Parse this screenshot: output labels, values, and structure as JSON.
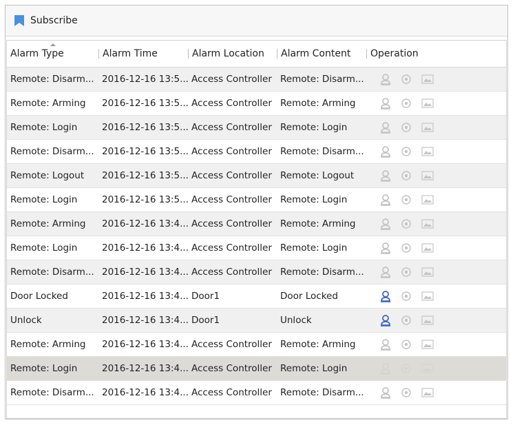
{
  "toolbar": {
    "subscribe_label": "Subscribe",
    "accent": "#4a8fe0"
  },
  "table": {
    "columns": [
      "Alarm Type",
      "Alarm Time",
      "Alarm Location",
      "Alarm Content",
      "Operation"
    ],
    "sorted_column": "Alarm Type",
    "selected_row": 12,
    "rows": [
      {
        "type": "Remote: Disarm...",
        "time": "2016-12-16 13:5...",
        "location": "Access Controller",
        "content": "Remote: Disarm...",
        "linkage_active": false
      },
      {
        "type": "Remote: Arming",
        "time": "2016-12-16 13:5...",
        "location": "Access Controller",
        "content": "Remote: Arming",
        "linkage_active": false
      },
      {
        "type": "Remote: Login",
        "time": "2016-12-16 13:5...",
        "location": "Access Controller",
        "content": "Remote: Login",
        "linkage_active": false
      },
      {
        "type": "Remote: Disarm...",
        "time": "2016-12-16 13:5...",
        "location": "Access Controller",
        "content": "Remote: Disarm...",
        "linkage_active": false
      },
      {
        "type": "Remote: Logout",
        "time": "2016-12-16 13:5...",
        "location": "Access Controller",
        "content": "Remote: Logout",
        "linkage_active": false
      },
      {
        "type": "Remote: Login",
        "time": "2016-12-16 13:5...",
        "location": "Access Controller",
        "content": "Remote: Login",
        "linkage_active": false
      },
      {
        "type": "Remote: Arming",
        "time": "2016-12-16 13:4...",
        "location": "Access Controller",
        "content": "Remote: Arming",
        "linkage_active": false
      },
      {
        "type": "Remote: Login",
        "time": "2016-12-16 13:4...",
        "location": "Access Controller",
        "content": "Remote: Login",
        "linkage_active": false
      },
      {
        "type": "Remote: Disarm...",
        "time": "2016-12-16 13:4...",
        "location": "Access Controller",
        "content": "Remote: Disarm...",
        "linkage_active": false
      },
      {
        "type": "Door Locked",
        "time": "2016-12-16 13:4...",
        "location": "Door1",
        "content": "Door Locked",
        "linkage_active": true
      },
      {
        "type": "Unlock",
        "time": "2016-12-16 13:4...",
        "location": "Door1",
        "content": "Unlock",
        "linkage_active": true
      },
      {
        "type": "Remote: Arming",
        "time": "2016-12-16 13:4...",
        "location": "Access Controller",
        "content": "Remote: Arming",
        "linkage_active": false
      },
      {
        "type": "Remote: Login",
        "time": "2016-12-16 13:4...",
        "location": "Access Controller",
        "content": "Remote: Login",
        "linkage_active": false
      },
      {
        "type": "Remote: Disarm...",
        "time": "2016-12-16 13:4...",
        "location": "Access Controller",
        "content": "Remote: Disarm...",
        "linkage_active": false
      }
    ]
  },
  "icons": {
    "operation": [
      "person-icon",
      "eye-icon",
      "picture-icon"
    ],
    "colors": {
      "active": "#3a68c4",
      "inactive": "#c4c4c4",
      "inactive_selected": "#d6d4cf"
    }
  }
}
